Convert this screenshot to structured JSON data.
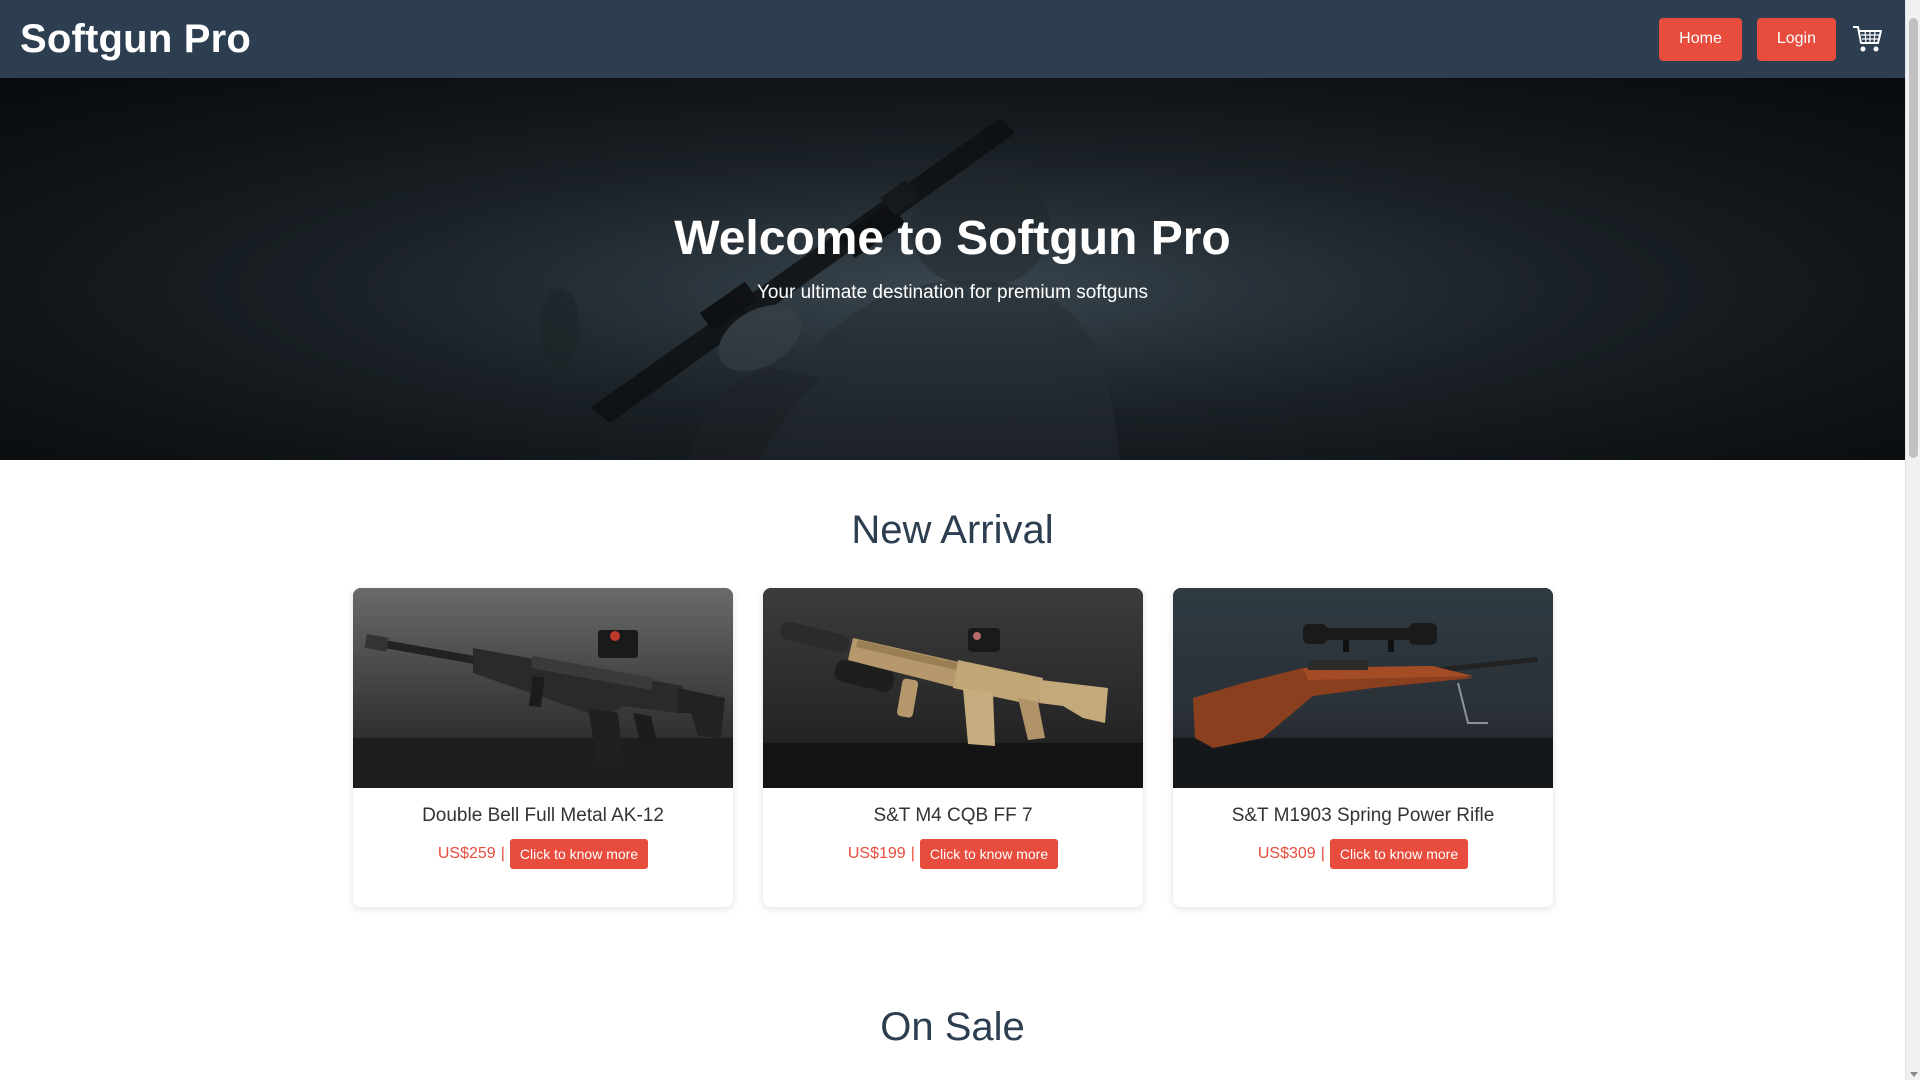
{
  "header": {
    "brand": "Softgun Pro",
    "nav": [
      {
        "label": "Home"
      },
      {
        "label": "Login"
      }
    ],
    "cart_icon": "shopping-cart-icon"
  },
  "hero": {
    "title": "Welcome to Softgun Pro",
    "subtitle": "Your ultimate destination for premium softguns"
  },
  "new_arrival": {
    "title": "New Arrival",
    "products": [
      {
        "name": "Double Bell Full Metal AK-12",
        "price": "US$259",
        "separator": "|",
        "button": "Click to know more"
      },
      {
        "name": "S&T M4 CQB FF 7",
        "price": "US$199",
        "separator": "|",
        "button": "Click to know more"
      },
      {
        "name": "S&T M1903 Spring Power Rifle",
        "price": "US$309",
        "separator": "|",
        "button": "Click to know more"
      }
    ]
  },
  "on_sale": {
    "title": "On Sale"
  },
  "colors": {
    "header_bg": "#2c3e50",
    "accent": "#e74c3c",
    "heading": "#2c3e50"
  }
}
